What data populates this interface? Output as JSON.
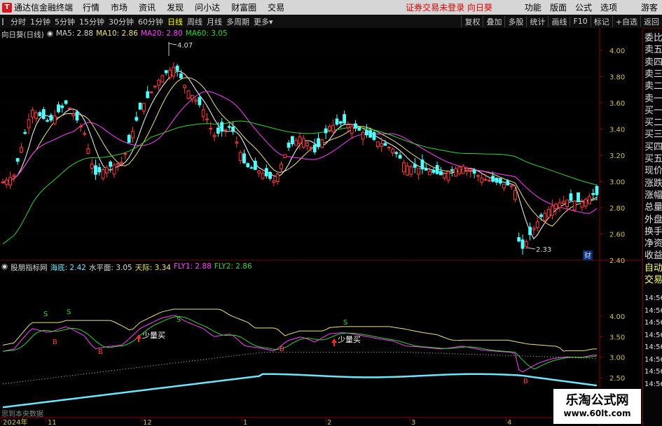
{
  "menubar": {
    "app_title": "通达信金融终端",
    "items": [
      "行情",
      "市场",
      "资讯",
      "发现",
      "问小达",
      "财富圈",
      "交易"
    ],
    "warning": "证券交易未登录",
    "stock": "向日葵",
    "right_items": [
      "功能",
      "版面",
      "公式",
      "选项"
    ],
    "guest": "游客"
  },
  "toolbar": {
    "periods": [
      "分时",
      "1分钟",
      "5分钟",
      "15分钟",
      "30分钟",
      "60分钟",
      "日线",
      "周线",
      "月线",
      "多周期",
      "更多"
    ],
    "active_period": "日线",
    "right_buttons": [
      "复权",
      "叠加",
      "多股",
      "统计",
      "画线",
      "F10",
      "标记",
      "+自选",
      "返回"
    ]
  },
  "main_legend": {
    "title": "向日葵(日线)",
    "ma5": "MA5: 2.88",
    "ma10": "MA10: 2.86",
    "ma20": "MA20: 2.80",
    "ma60": "MA60: 3.05"
  },
  "sub_legend": {
    "title": "股朋指标网",
    "haidi": "海底: 2.42",
    "shuipingmian": "水平面: 3.05",
    "tianji": "天际: 3.34",
    "fly1": "FLY1: 2.88",
    "fly2": "FLY2: 2.86"
  },
  "price_axis": [
    "4.00",
    "3.80",
    "3.60",
    "3.40",
    "3.20",
    "3.00",
    "2.80",
    "2.60",
    "2.40"
  ],
  "sub_axis": [
    "4.00",
    "3.50",
    "3.00",
    "2.50"
  ],
  "annotations": {
    "high": "4.07",
    "low": "2.33",
    "cai": "财",
    "signal_s": "S",
    "signal_b": "B",
    "less_buy": "少量买"
  },
  "date_axis": [
    "2024年",
    "11",
    "12",
    "1",
    "2",
    "3",
    "4"
  ],
  "right_panel": [
    "委比",
    "卖五",
    "卖四",
    "卖三",
    "卖二",
    "卖一",
    "买一",
    "买二",
    "买三",
    "买四",
    "买五",
    "现价",
    "涨跌",
    "涨幅",
    "总量",
    "外盘",
    "换手",
    "净资",
    "收益",
    "自动",
    "交易"
  ],
  "time_list": [
    "14:56",
    "14:56",
    "14:56",
    "14:56",
    "14:56",
    "14:56",
    "14:56",
    "14:56"
  ],
  "bottom_note": "思到本央数据",
  "watermark": {
    "line1": "乐淘公式网",
    "line2": "www.60lt.com"
  },
  "colors": {
    "up": "#ff3c3c",
    "down": "#54ffff",
    "ma5": "#ffffff",
    "ma10": "#f2e27a",
    "ma20": "#ff40ff",
    "ma60": "#30d630"
  }
}
